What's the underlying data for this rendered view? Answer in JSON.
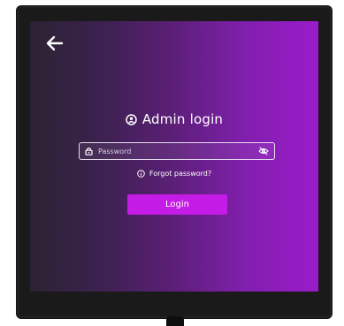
{
  "header": {
    "back_icon": "arrow-left-icon"
  },
  "login": {
    "title": "Admin login",
    "title_icon": "user-circle-icon",
    "password": {
      "placeholder": "Password",
      "value": "",
      "lock_icon": "lock-icon",
      "visibility_icon": "eye-off-icon"
    },
    "forgot_password": {
      "label": "Forgot password?",
      "icon": "info-icon"
    },
    "submit_label": "Login"
  },
  "colors": {
    "gradient_start": "#2b2233",
    "gradient_end": "#9b1bcc",
    "accent": "#c51be6",
    "text": "#ffffff"
  }
}
